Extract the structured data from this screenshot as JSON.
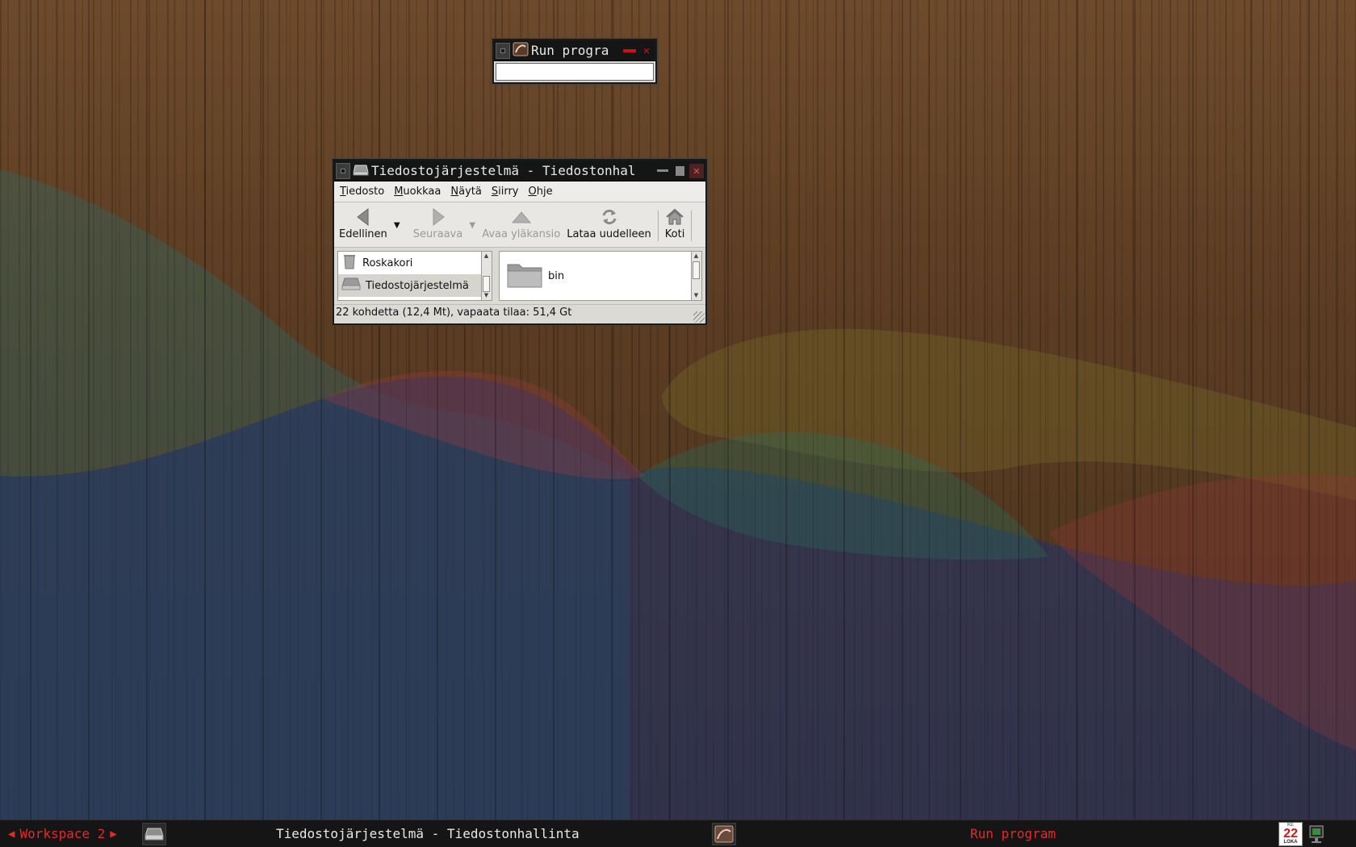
{
  "run_window": {
    "title": "Run progra",
    "input_value": ""
  },
  "file_manager": {
    "title": "Tiedostojärjestelmä - Tiedostonhal",
    "menu": [
      {
        "label": "Tiedosto",
        "underline": "T"
      },
      {
        "label": "Muokkaa",
        "underline": "M"
      },
      {
        "label": "Näytä",
        "underline": "N"
      },
      {
        "label": "Siirry",
        "underline": "S"
      },
      {
        "label": "Ohje",
        "underline": "O"
      }
    ],
    "toolbar": {
      "back": "Edellinen",
      "forward": "Seuraava",
      "up": "Avaa yläkansio",
      "reload": "Lataa uudelleen",
      "home": "Koti"
    },
    "sidebar": [
      {
        "label": "Roskakori",
        "icon": "trash-icon",
        "selected": false
      },
      {
        "label": "Tiedostojärjestelmä",
        "icon": "drive-icon",
        "selected": true
      }
    ],
    "files": [
      {
        "name": "bin",
        "icon": "folder-icon"
      }
    ],
    "status": "22 kohdetta (12,4 Mt), vapaata tilaa: 51,4 Gt"
  },
  "taskbar": {
    "workspace": "Workspace 2",
    "tasks": [
      {
        "label": "Tiedostojärjestelmä - Tiedostonhallinta",
        "active": true
      },
      {
        "label": "Run program",
        "active": false
      }
    ],
    "calendar": {
      "weekday": "KE",
      "day": "22",
      "month": "LOKA"
    }
  },
  "colors": {
    "accent_red": "#e32a2a",
    "titlebar": "#151515",
    "window_bg": "#dcdad5"
  }
}
